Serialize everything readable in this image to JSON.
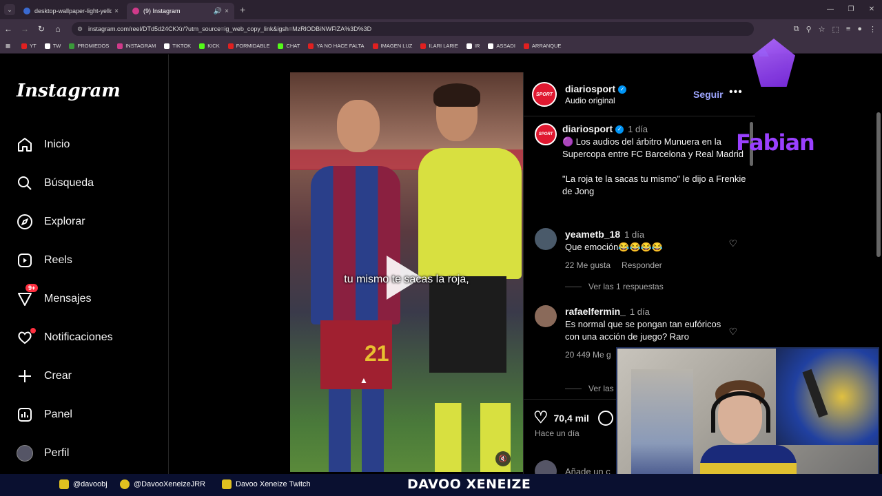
{
  "browser": {
    "tabs": [
      {
        "title": "desktop-wallpaper-light-yellow",
        "close": "×"
      },
      {
        "title": "(9) Instagram",
        "close": "×"
      }
    ],
    "new_tab": "+",
    "url": "instagram.com/reel/DTd5d24CKXr/?utm_source=ig_web_copy_link&igsh=MzRlODBiNWFlZA%3D%3D",
    "bookmarks": [
      {
        "label": "YT",
        "color": "#e02020"
      },
      {
        "label": "TW",
        "color": "#ffffff"
      },
      {
        "label": "PROMIEDOS",
        "color": "#3a9a3a"
      },
      {
        "label": "INSTAGRAM",
        "color": "#d03a8a"
      },
      {
        "label": "TIKTOK",
        "color": "#ffffff"
      },
      {
        "label": "KICK",
        "color": "#53fc18"
      },
      {
        "label": "FORMIDABLE",
        "color": "#e02020"
      },
      {
        "label": "CHAT",
        "color": "#53fc18"
      },
      {
        "label": "YA NO HACE FALTA",
        "color": "#e02020"
      },
      {
        "label": "IMAGEN LUZ",
        "color": "#e02020"
      },
      {
        "label": "ILARI LARIE",
        "color": "#e02020"
      },
      {
        "label": "IR",
        "color": "#ffffff"
      },
      {
        "label": "ASSADI",
        "color": "#ffffff"
      },
      {
        "label": "ARRANQUE",
        "color": "#e02020"
      }
    ]
  },
  "instagram": {
    "logo": "Instagram",
    "nav": [
      {
        "label": "Inicio",
        "icon": "home-icon"
      },
      {
        "label": "Búsqueda",
        "icon": "search-icon"
      },
      {
        "label": "Explorar",
        "icon": "compass-icon"
      },
      {
        "label": "Reels",
        "icon": "reels-icon"
      },
      {
        "label": "Mensajes",
        "icon": "messenger-icon",
        "badge": "9+"
      },
      {
        "label": "Notificaciones",
        "icon": "heart-icon"
      },
      {
        "label": "Crear",
        "icon": "plus-icon"
      },
      {
        "label": "Panel",
        "icon": "chart-icon"
      },
      {
        "label": "Perfil",
        "icon": "avatar"
      }
    ],
    "video": {
      "subtitle": "tu mismo te sacas la roja,"
    },
    "post": {
      "avatar_text": "SPORT",
      "username": "diariosport",
      "audio": "Audio original",
      "follow": "Seguir",
      "more": "•••",
      "caption_user": "diariosport",
      "caption_time": "1 día",
      "caption": "🟣 Los audios del árbitro Munuera en la Supercopa entre FC Barcelona y Real Madrid",
      "caption2": "\"La roja te la sacas tu mismo\" le dijo a Frenkie de Jong",
      "comments": [
        {
          "user": "yeametb_18",
          "time": "1 día",
          "text": "Que emoción😂😂😂😂",
          "likes": "22 Me gusta",
          "reply": "Responder",
          "replies": "Ver las 1 respuestas"
        },
        {
          "user": "rafaelfermin_",
          "time": "1 día",
          "text": "Es normal que se pongan tan eufóricos con una acción de juego? Raro",
          "likes": "20 449 Me g",
          "replies": "Ver las"
        }
      ],
      "like_count": "70,4 mil",
      "posted": "Hace un día",
      "add_comment": "Añade un c"
    }
  },
  "overlay": {
    "name": "Fabian",
    "bottom": {
      "instagram": "@davoobj",
      "twitter": "@DavooXeneizeJRR",
      "twitch": "Davoo Xeneize Twitch",
      "brand": "DAVOO XENEIZE"
    }
  }
}
